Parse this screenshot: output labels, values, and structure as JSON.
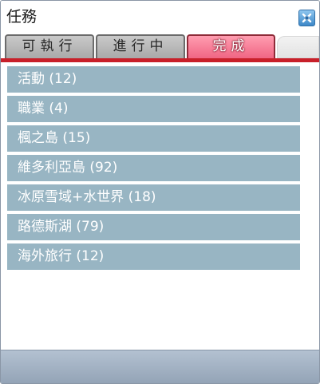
{
  "window": {
    "title": "任務"
  },
  "tabs": [
    {
      "label": "可執行",
      "active": false
    },
    {
      "label": "進行中",
      "active": false
    },
    {
      "label": "完成",
      "active": true
    }
  ],
  "quest_categories": [
    {
      "label": "活動 (12)"
    },
    {
      "label": "職業 (4)"
    },
    {
      "label": "楓之島 (15)"
    },
    {
      "label": "維多利亞島 (92)"
    },
    {
      "label": "冰原雪域+水世界 (18)"
    },
    {
      "label": "路德斯湖 (79)"
    },
    {
      "label": "海外旅行 (12)"
    }
  ],
  "colors": {
    "active_tab": "#f06684",
    "tab_underline": "#c8202a",
    "list_item_bg": "#98b5c3",
    "footer_bg": "#a3b2c4"
  },
  "icons": {
    "close": "close-icon"
  }
}
